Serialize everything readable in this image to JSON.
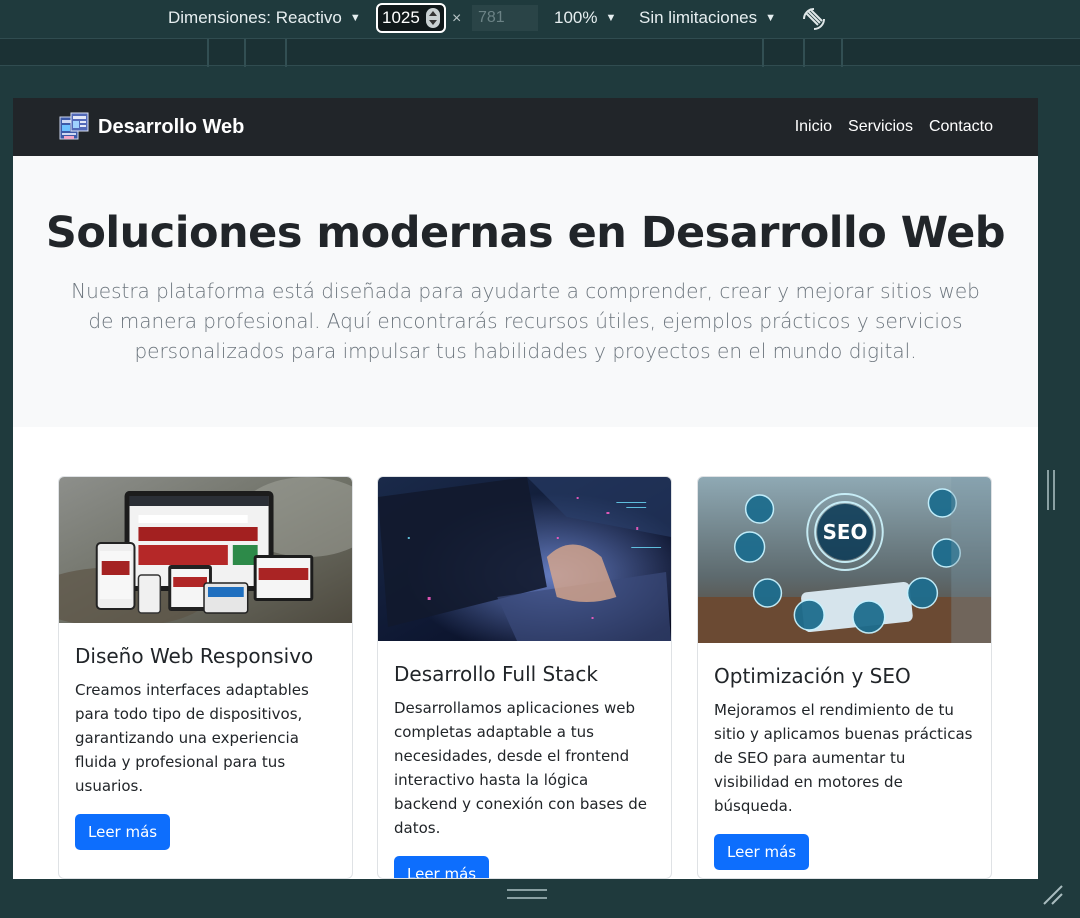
{
  "devtools": {
    "dimensions_label": "Dimensiones: Reactivo",
    "width_value": "1025",
    "height_value": "781",
    "times_symbol": "×",
    "zoom_label": "100%",
    "throttle_label": "Sin limitaciones"
  },
  "navbar": {
    "brand": "Desarrollo Web",
    "links": [
      "Inicio",
      "Servicios",
      "Contacto"
    ]
  },
  "hero": {
    "title": "Soluciones modernas en Desarrollo Web",
    "lead": "Nuestra plataforma está diseñada para ayudarte a comprender, crear y mejorar sitios web de manera profesional. Aquí encontrarás recursos útiles, ejemplos prácticos y servicios personalizados para impulsar tus habilidades y proyectos en el mundo digital."
  },
  "cards": [
    {
      "title": "Diseño Web Responsivo",
      "text": "Creamos interfaces adaptables para todo tipo de dispositivos, garantizando una experiencia fluida y profesional para tus usuarios.",
      "button": "Leer más"
    },
    {
      "title": "Desarrollo Full Stack",
      "text": "Desarrollamos aplicaciones web completas adaptable a tus necesidades, desde el frontend interactivo hasta la lógica backend y conexión con bases de datos.",
      "button": "Leer más"
    },
    {
      "title": "Optimización y SEO",
      "text": "Mejoramos el rendimiento de tu sitio y aplicamos buenas prácticas de SEO para aumentar tu visibilidad en motores de búsqueda.",
      "button": "Leer más"
    }
  ],
  "images": {
    "seo_badge": "SEO"
  },
  "colors": {
    "navbar_bg": "#212529",
    "hero_bg": "#f8f9fa",
    "primary": "#0d6efd",
    "devtools_bg": "#1f3a3d"
  }
}
